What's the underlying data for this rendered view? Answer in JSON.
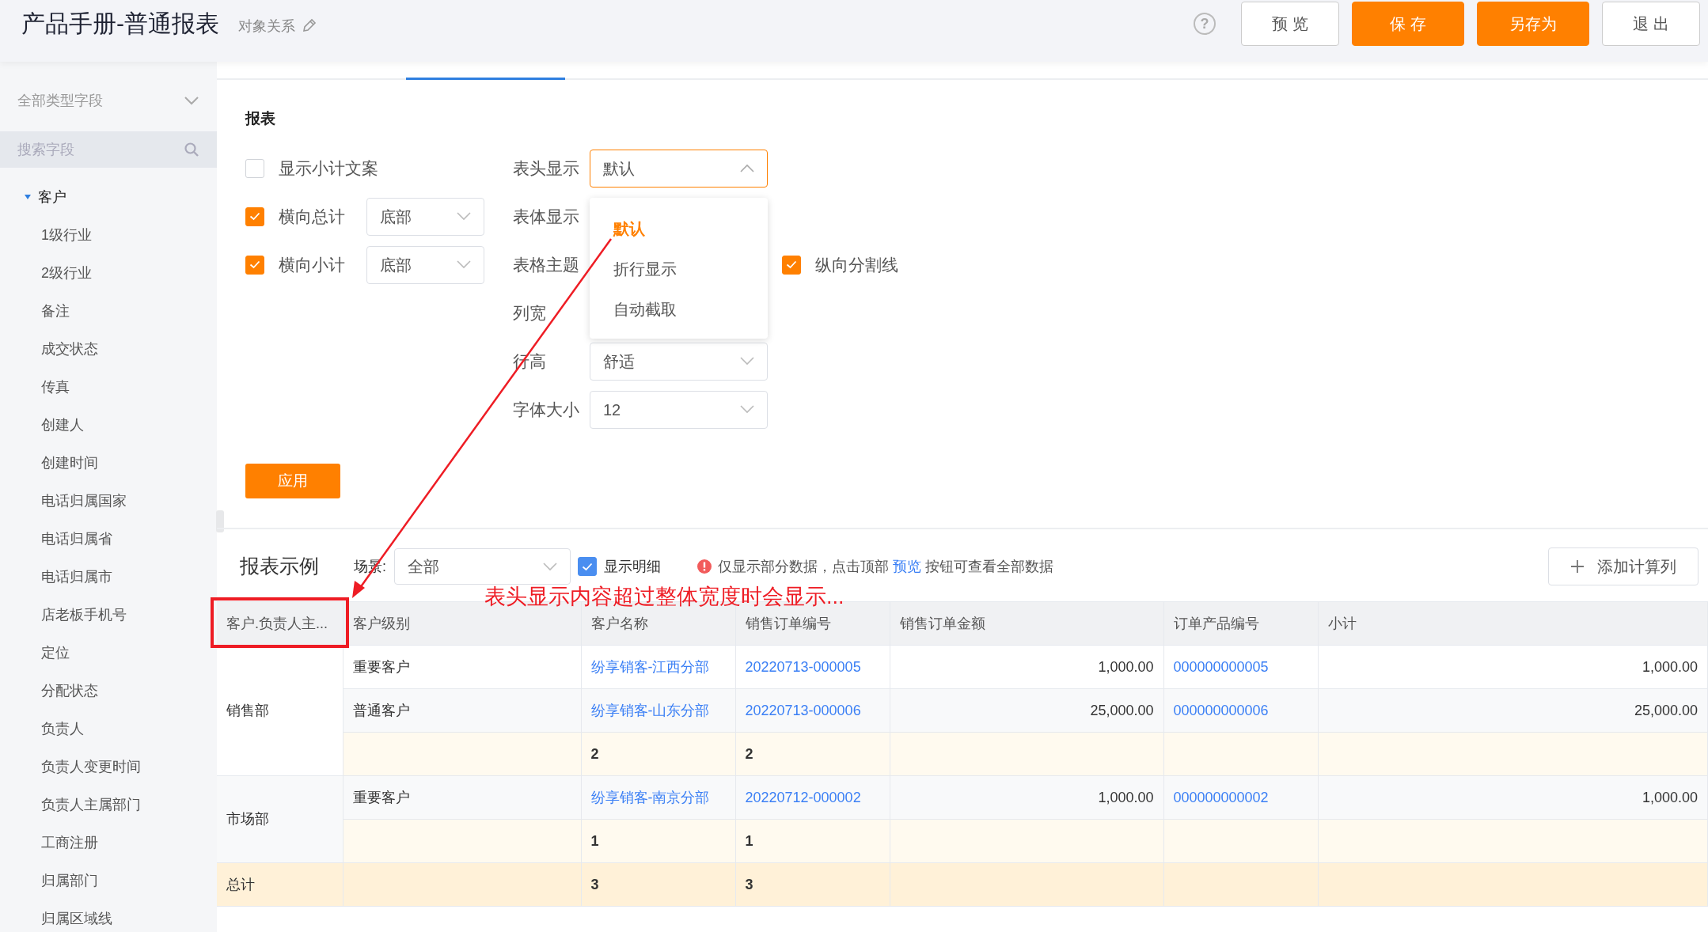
{
  "header": {
    "title": "产品手册-普通报表",
    "subtitle": "对象关系",
    "help": "?",
    "buttons": [
      {
        "label": "预 览",
        "kind": "default"
      },
      {
        "label": "保 存",
        "kind": "primary"
      },
      {
        "label": "另存为",
        "kind": "primary"
      },
      {
        "label": "退 出",
        "kind": "default"
      }
    ]
  },
  "sidebar": {
    "type_filter": "全部类型字段",
    "search": {
      "placeholder": "搜索字段"
    },
    "tree": [
      {
        "label": "客户",
        "expanded": true,
        "children": [
          {
            "label": "1级行业"
          },
          {
            "label": "2级行业"
          },
          {
            "label": "备注"
          },
          {
            "label": "成交状态"
          },
          {
            "label": "传真"
          },
          {
            "label": "创建人"
          },
          {
            "label": "创建时间"
          },
          {
            "label": "电话归属国家"
          },
          {
            "label": "电话归属省"
          },
          {
            "label": "电话归属市"
          },
          {
            "label": "店老板手机号"
          },
          {
            "label": "定位"
          },
          {
            "label": "分配状态"
          },
          {
            "label": "负责人"
          },
          {
            "label": "负责人变更时间"
          },
          {
            "label": "负责人主属部门"
          },
          {
            "label": "工商注册"
          },
          {
            "label": "归属部门"
          },
          {
            "label": "归属区域线"
          }
        ]
      }
    ]
  },
  "settings": {
    "title": "报表",
    "options": [
      {
        "label": "显示小计文案",
        "checked": false
      },
      {
        "label": "横向总计",
        "checked": true,
        "value": "底部"
      },
      {
        "label": "横向小计",
        "checked": true,
        "value": "底部"
      }
    ],
    "fields": [
      {
        "label": "表头显示",
        "value": "默认",
        "open": true
      },
      {
        "label": "表体显示"
      },
      {
        "label": "表格主题",
        "extra": {
          "label": "纵向分割线",
          "checked": true
        }
      },
      {
        "label": "列宽"
      },
      {
        "label": "行高",
        "value": "舒适",
        "open": false
      },
      {
        "label": "字体大小",
        "value": "12",
        "open": false
      }
    ],
    "menu": [
      {
        "label": "默认",
        "selected": true
      },
      {
        "label": "折行显示",
        "selected": false
      },
      {
        "label": "自动截取",
        "selected": false
      }
    ],
    "apply": "应用"
  },
  "example": {
    "title": "报表示例",
    "scene_label": "场景:",
    "scene_value": "全部",
    "show_detail": {
      "label": "显示明细",
      "checked": true
    },
    "notice": {
      "before": "仅显示部分数据，点击顶部",
      "link": "预览",
      "after": "按钮可查看全部数据"
    },
    "add_button": "添加计算列",
    "annotation": "表头显示内容超过整体宽度时会显示...",
    "table": {
      "columns": [
        {
          "label": "客户.负责人主...",
          "kind": "text"
        },
        {
          "label": "客户级别",
          "kind": "text"
        },
        {
          "label": "客户名称",
          "kind": "link"
        },
        {
          "label": "销售订单编号",
          "kind": "link"
        },
        {
          "label": "销售订单金额",
          "kind": "number"
        },
        {
          "label": "订单产品编号",
          "kind": "link"
        },
        {
          "label": "小计",
          "kind": "number"
        }
      ],
      "groups": [
        {
          "label": "销售部",
          "rows": [
            {
              "kind": "data",
              "cells": [
                "重要客户",
                "纷享销客-江西分部",
                "20220713-000005",
                "1,000.00",
                "000000000005",
                "1,000.00"
              ]
            },
            {
              "kind": "data",
              "cells": [
                "普通客户",
                "纷享销客-山东分部",
                "20220713-000006",
                "25,000.00",
                "000000000006",
                "25,000.00"
              ]
            },
            {
              "kind": "subtotal",
              "cells": [
                null,
                "2",
                "2",
                null,
                null,
                null
              ]
            }
          ]
        },
        {
          "label": "市场部",
          "rows": [
            {
              "kind": "data",
              "cells": [
                "重要客户",
                "纷享销客-南京分部",
                "20220712-000002",
                "1,000.00",
                "000000000002",
                "1,000.00"
              ]
            },
            {
              "kind": "subtotal",
              "cells": [
                null,
                "1",
                "1",
                null,
                null,
                null
              ]
            }
          ]
        }
      ],
      "total": {
        "label": "总计",
        "cells": [
          null,
          "3",
          "3",
          null,
          null,
          null
        ]
      }
    }
  }
}
